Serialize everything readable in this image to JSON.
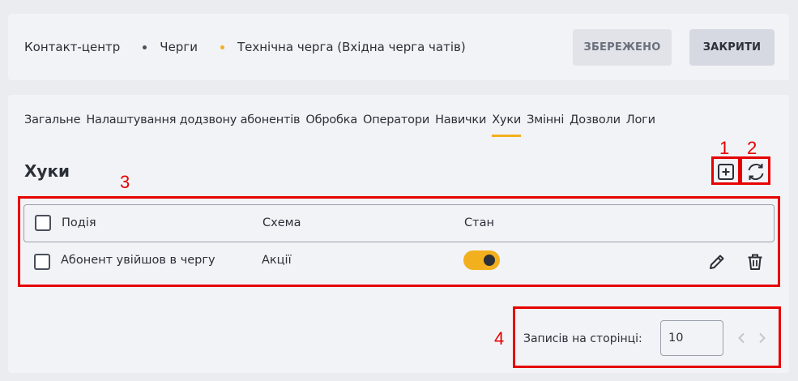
{
  "breadcrumb": {
    "items": [
      "Контакт-центр",
      "Черги",
      "Технічна черга (Вхідна черга чатів)"
    ],
    "separator_colors": [
      "#4a4f5c",
      "#f2b01e"
    ]
  },
  "header_buttons": {
    "saved_label": "ЗБЕРЕЖЕНО",
    "close_label": "ЗАКРИТИ"
  },
  "tabs": [
    {
      "label": "Загальне",
      "active": false
    },
    {
      "label": "Налаштування додзвону абонентів",
      "active": false
    },
    {
      "label": "Обробка",
      "active": false
    },
    {
      "label": "Оператори",
      "active": false
    },
    {
      "label": "Навички",
      "active": false
    },
    {
      "label": "Хуки",
      "active": true
    },
    {
      "label": "Змінні",
      "active": false
    },
    {
      "label": "Дозволи",
      "active": false
    },
    {
      "label": "Логи",
      "active": false
    }
  ],
  "section": {
    "title": "Хуки",
    "icons": [
      "add-square-icon",
      "refresh-icon"
    ]
  },
  "table": {
    "columns": [
      "Подія",
      "Схема",
      "Стан"
    ],
    "rows": [
      {
        "event": "Абонент увійшов в чергу",
        "scheme": "Акції",
        "state_on": true,
        "icons": [
          "pencil-icon",
          "trash-icon"
        ]
      }
    ]
  },
  "pagination": {
    "label": "Записів на сторінці:",
    "per_page": "10"
  },
  "annotations": {
    "numbers": [
      "1",
      "2",
      "3",
      "4"
    ],
    "color": "#e60000"
  },
  "colors": {
    "accent": "#f2b01e",
    "background": "#ebecf0",
    "panel": "#f2f3f6"
  }
}
